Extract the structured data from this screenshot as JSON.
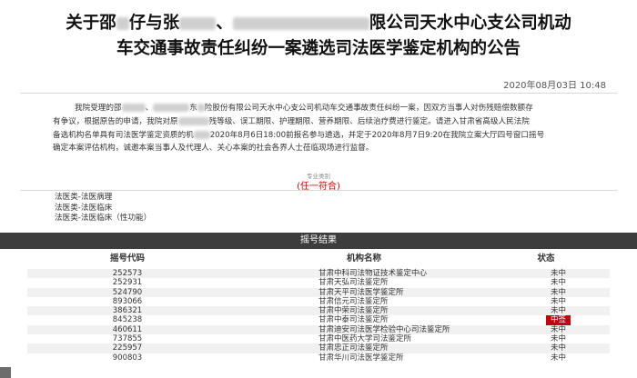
{
  "announcement": {
    "title_line1_parts": [
      "关于邵",
      "仔与张",
      "、",
      "限公司天水中心支公司机动"
    ],
    "title_line2": "车交通事故责任纠纷一案遴选司法医学鉴定机构的公告",
    "date": "2020年08月03日  10:48",
    "para1_parts": [
      "我院受理的邵",
      "、",
      "东",
      "险股份有限公司天水中心支公司机动车交通事故责任纠纷一案，因双方当事人对伤残赔偿数额存"
    ],
    "para2": "有争议，根据原告的申请，我院对原",
    "para2b": "残等级、误工期限、护理期限、营养期限、后续治疗费进行鉴定。请进入甘肃省高级人民法院",
    "para3": "备选机构名单具有司法医学鉴定资质的机",
    "para3b": "2020年8月6日18:00前报名参与遴选，并定于2020年8月7日9:20在我院立案大厅四号窗口摇号",
    "para4": "确定本案评估机构，诚邀本案当事人及代理人、关心本案的社会各界人士莅临现场进行监督。",
    "specialty_label": "专业类别",
    "specialty_rule": "(任一符合)",
    "specialties": [
      "法医类-法医病理",
      "法医类-法医临床",
      "法医类-法医临床（性功能）"
    ]
  },
  "lottery": {
    "section_title": "摇号结果",
    "headers": [
      "摇号代码",
      "机构名称",
      "状态"
    ],
    "rows": [
      {
        "code": "252573",
        "name": "甘肃中科司法物证技术鉴定中心",
        "status": "未中"
      },
      {
        "code": "252931",
        "name": "甘肃天弘司法鉴定所",
        "status": "未中"
      },
      {
        "code": "524790",
        "name": "甘肃天平司法医学鉴定所",
        "status": "未中"
      },
      {
        "code": "893066",
        "name": "甘肃信元司法鉴定所",
        "status": "未中"
      },
      {
        "code": "386321",
        "name": "甘肃中荣司法鉴定所",
        "status": "未中"
      },
      {
        "code": "845238",
        "name": "甘肃中泰司法鉴定所",
        "status": "中签"
      },
      {
        "code": "460611",
        "name": "甘肃迪安司法医学检验中心司法鉴定所",
        "status": "未中"
      },
      {
        "code": "737855",
        "name": "甘肃中医药大学司法鉴定所",
        "status": "未中"
      },
      {
        "code": "225957",
        "name": "甘肃忠正司法鉴定所",
        "status": "未中"
      },
      {
        "code": "900803",
        "name": "甘肃华川司法医学鉴定所",
        "status": "未中"
      }
    ]
  },
  "colors": {
    "selected_badge": "#c4000d",
    "result_bar": "#3d3d3d"
  }
}
